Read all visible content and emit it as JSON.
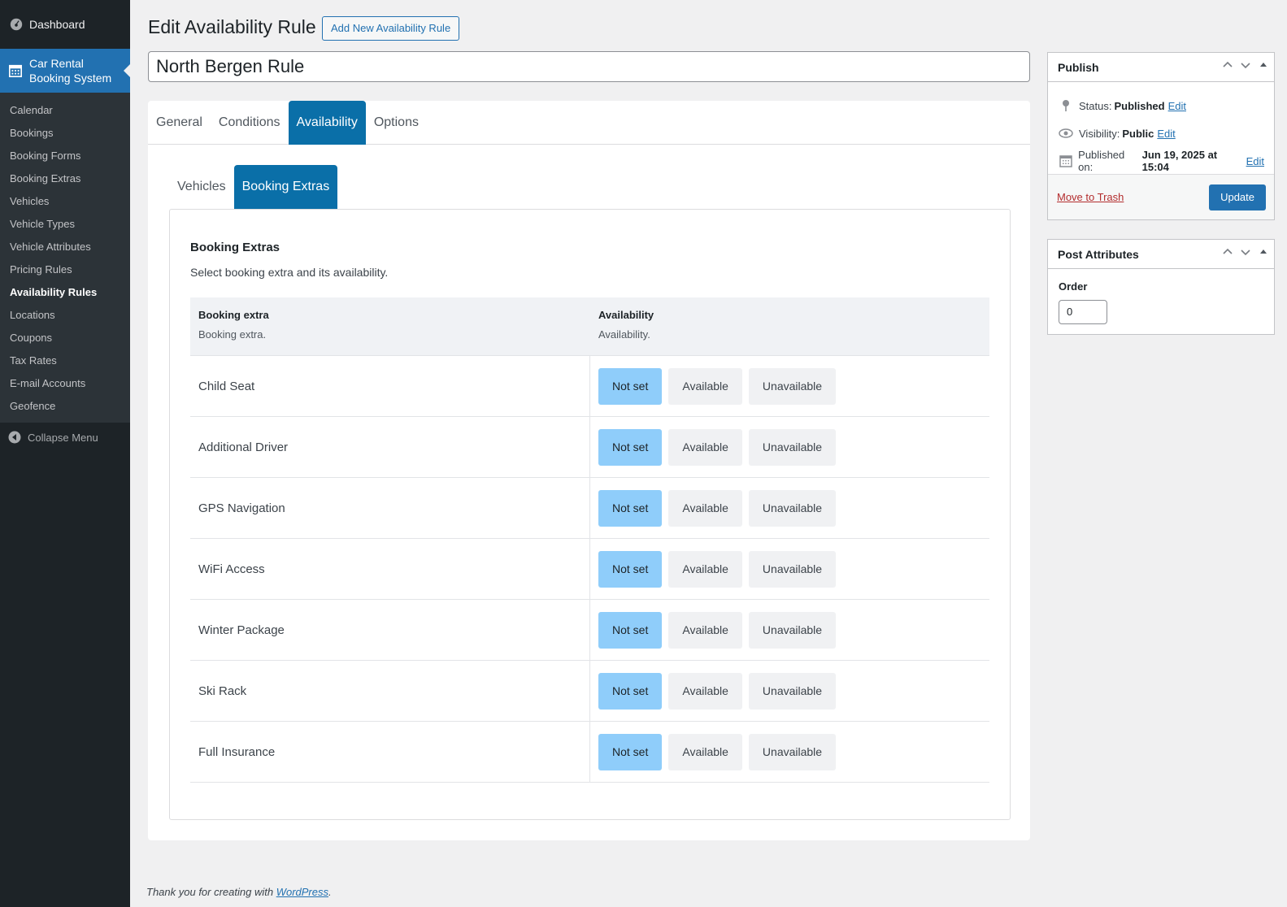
{
  "sidebar": {
    "dashboard": "Dashboard",
    "current_menu": "Car Rental Booking System",
    "items": [
      {
        "label": "Calendar"
      },
      {
        "label": "Bookings"
      },
      {
        "label": "Booking Forms"
      },
      {
        "label": "Booking Extras"
      },
      {
        "label": "Vehicles"
      },
      {
        "label": "Vehicle Types"
      },
      {
        "label": "Vehicle Attributes"
      },
      {
        "label": "Pricing Rules"
      },
      {
        "label": "Availability Rules"
      },
      {
        "label": "Locations"
      },
      {
        "label": "Coupons"
      },
      {
        "label": "Tax Rates"
      },
      {
        "label": "E-mail Accounts"
      },
      {
        "label": "Geofence"
      }
    ],
    "active_item": "Availability Rules",
    "collapse": "Collapse Menu"
  },
  "header": {
    "title": "Edit Availability Rule",
    "add_new": "Add New Availability Rule",
    "post_title": "North Bergen Rule"
  },
  "tabs": [
    "General",
    "Conditions",
    "Availability",
    "Options"
  ],
  "active_tab": "Availability",
  "subtabs": [
    "Vehicles",
    "Booking Extras"
  ],
  "active_subtab": "Booking Extras",
  "section": {
    "title": "Booking Extras",
    "description": "Select booking extra and its availability."
  },
  "table": {
    "col1_header": "Booking extra",
    "col1_desc": "Booking extra.",
    "col2_header": "Availability",
    "col2_desc": "Availability.",
    "options": [
      "Not set",
      "Available",
      "Unavailable"
    ],
    "rows": [
      {
        "name": "Child Seat",
        "selected": "Not set"
      },
      {
        "name": "Additional Driver",
        "selected": "Not set"
      },
      {
        "name": "GPS Navigation",
        "selected": "Not set"
      },
      {
        "name": "WiFi Access",
        "selected": "Not set"
      },
      {
        "name": "Winter Package",
        "selected": "Not set"
      },
      {
        "name": "Ski Rack",
        "selected": "Not set"
      },
      {
        "name": "Full Insurance",
        "selected": "Not set"
      }
    ]
  },
  "publish": {
    "title": "Publish",
    "status_label": "Status:",
    "status_value": "Published",
    "visibility_label": "Visibility:",
    "visibility_value": "Public",
    "published_label": "Published on:",
    "published_value": "Jun 19, 2025 at 15:04",
    "edit": "Edit",
    "trash": "Move to Trash",
    "update": "Update"
  },
  "attributes": {
    "title": "Post Attributes",
    "order_label": "Order",
    "order_value": "0"
  },
  "footer": {
    "text": "Thank you for creating with",
    "link": "WordPress",
    "suffix": "."
  },
  "colors": {
    "accent": "#2271b1",
    "tab_active": "#0a6fa8",
    "selected_option": "#8fcdfa",
    "sidebar": "#1d2327"
  }
}
